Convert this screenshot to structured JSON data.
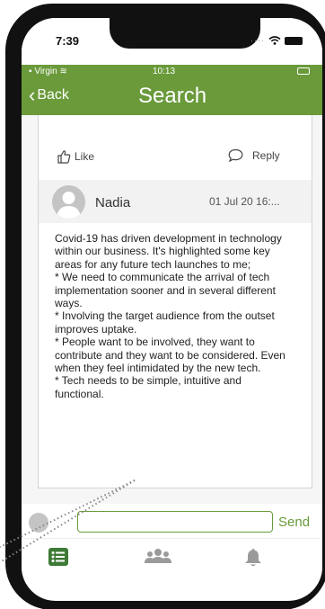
{
  "device": {
    "clock": "7:39"
  },
  "app_status": {
    "carrier": "Virgin",
    "time": "10:13"
  },
  "navbar": {
    "back_label": "Back",
    "title": "Search"
  },
  "post_actions": {
    "like_label": "Like",
    "reply_label": "Reply"
  },
  "reply": {
    "author": "Nadia",
    "date": "01 Jul 20 16:...",
    "body": "Covid-19 has driven development in technology within our business. It's highlighted some key areas for any future tech launches to me;\n* We need to communicate the arrival of tech implementation sooner and in several different ways.\n* Involving the target audience from the outset improves uptake.\n* People want to be involved, they want to contribute and they want to be considered. Even when they feel intimidated by the new tech.\n* Tech needs to be simple, intuitive and functional."
  },
  "comment": {
    "input_value": "",
    "send_label": "Send"
  },
  "tabbar": {
    "tabs": [
      {
        "icon": "list-icon",
        "active": true
      },
      {
        "icon": "group-icon",
        "active": false
      },
      {
        "icon": "bell-icon",
        "active": false
      }
    ]
  },
  "colors": {
    "brand_green": "#6a9a3a",
    "active_tab": "#3d7a35",
    "inactive_tab": "#9a9a9a"
  }
}
